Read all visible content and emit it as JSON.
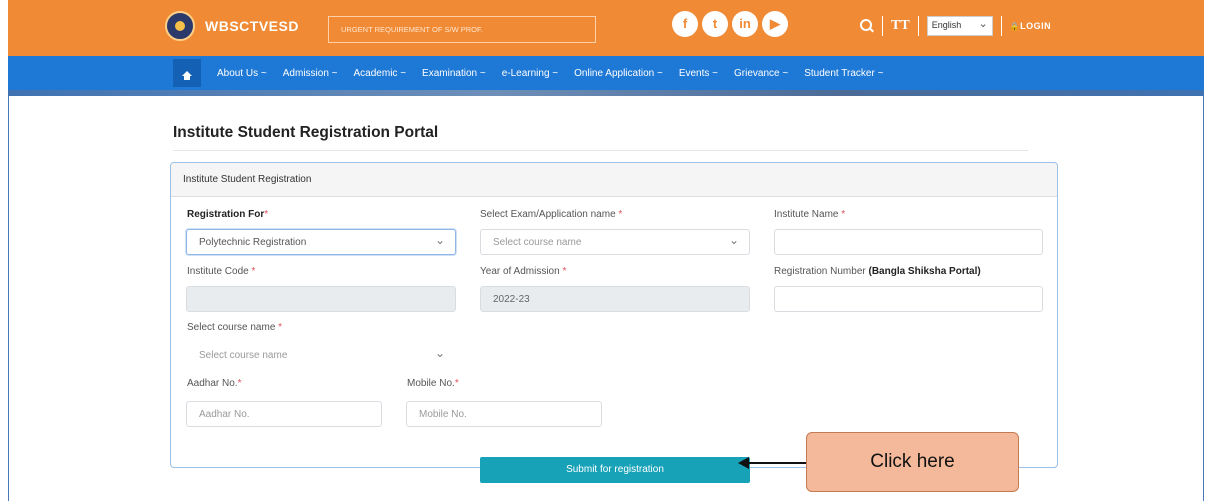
{
  "header": {
    "brand": "WBSCTVESD",
    "ticker": "URGENT REQUIREMENT OF S/W PROF.",
    "social": [
      {
        "name": "facebook-icon",
        "glyph": "f"
      },
      {
        "name": "twitter-icon",
        "glyph": "t"
      },
      {
        "name": "linkedin-icon",
        "glyph": "in"
      },
      {
        "name": "youtube-icon",
        "glyph": "▶"
      }
    ],
    "font_icon": "TT",
    "language": "English",
    "login": "LOGIN",
    "login_glyph": "🔒",
    "colors": {
      "topbar": "#f08a35",
      "navbar": "#1e78d6"
    }
  },
  "nav": {
    "items": [
      "About Us ~",
      "Admission ~",
      "Academic ~",
      "Examination ~",
      "e-Learning ~",
      "Online Application ~",
      "Events ~",
      "Grievance ~",
      "Student Tracker ~"
    ]
  },
  "page": {
    "title": "Institute Student Registration Portal",
    "panel_title": "Institute Student Registration"
  },
  "form": {
    "registration_for": {
      "label": "Registration For",
      "value": "Polytechnic Registration"
    },
    "exam_name": {
      "label": "Select Exam/Application name",
      "placeholder": "Select course name"
    },
    "institute_name": {
      "label": "Institute Name",
      "value": ""
    },
    "institute_code": {
      "label": "Institute Code",
      "value": ""
    },
    "year_of_admission": {
      "label": "Year of Admission",
      "value": "2022-23"
    },
    "registration_number": {
      "label": "Registration Number ",
      "label_bold": "(Bangla Shiksha Portal)",
      "value": ""
    },
    "course_name": {
      "label": "Select course name",
      "placeholder": "Select course name"
    },
    "aadhar": {
      "label": "Aadhar No.",
      "placeholder": "Aadhar No."
    },
    "mobile": {
      "label": "Mobile No.",
      "placeholder": "Mobile No."
    },
    "required_mark": "*",
    "submit_label": "Submit for registration"
  },
  "annotation": {
    "callout_text": "Click here"
  }
}
